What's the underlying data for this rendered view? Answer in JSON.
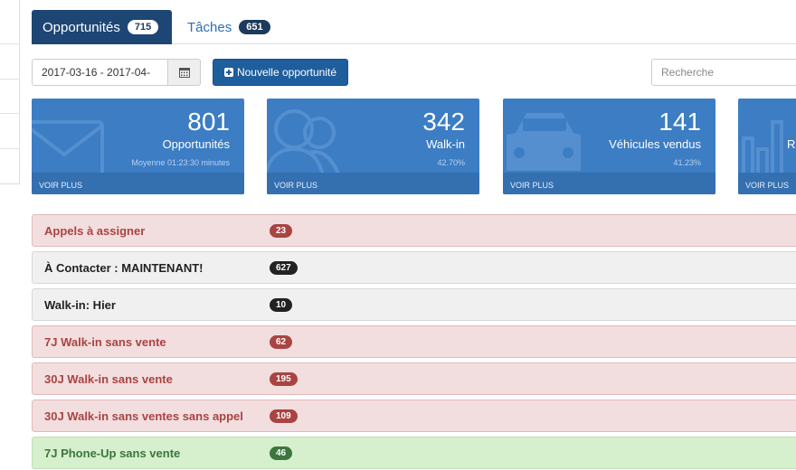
{
  "tabs": [
    {
      "label": "Opportunités",
      "count": "715"
    },
    {
      "label": "Tâches",
      "count": "651"
    }
  ],
  "toolbar": {
    "date_range": "2017-03-16 - 2017-04-",
    "new_button_label": "Nouvelle opportunité",
    "search_placeholder": "Recherche"
  },
  "cards": [
    {
      "value": "801",
      "label": "Opportunités",
      "sub": "Moyenne 01:23:30 minutes",
      "link": "VOIR PLUS",
      "icon": "envelope-icon"
    },
    {
      "value": "342",
      "label": "Walk-in",
      "sub": "42.70%",
      "link": "VOIR PLUS",
      "icon": "users-icon"
    },
    {
      "value": "141",
      "label": "Véhicules vendus",
      "sub": "41.23%",
      "link": "VOIR PLUS",
      "icon": "car-icon"
    },
    {
      "value": "",
      "label": "Ra",
      "sub": "",
      "link": "VOIR PLUS",
      "icon": "bar-chart-icon"
    }
  ],
  "rows": [
    {
      "label": "Appels à assigner",
      "count": "23",
      "status": "red"
    },
    {
      "label": "À Contacter : MAINTENANT!",
      "count": "627",
      "status": "gray"
    },
    {
      "label": "Walk-in: Hier",
      "count": "10",
      "status": "gray"
    },
    {
      "label": "7J Walk-in sans vente",
      "count": "62",
      "status": "red"
    },
    {
      "label": "30J Walk-in sans vente",
      "count": "195",
      "status": "red"
    },
    {
      "label": "30J Walk-in sans ventes sans appel",
      "count": "109",
      "status": "red"
    },
    {
      "label": "7J Phone-Up sans vente",
      "count": "46",
      "status": "green"
    }
  ],
  "colors": {
    "tab_active": "#1d4675",
    "primary_button": "#1f5e9c",
    "card": "#3c7dc4",
    "danger": "#a94442",
    "success": "#3c763d"
  }
}
